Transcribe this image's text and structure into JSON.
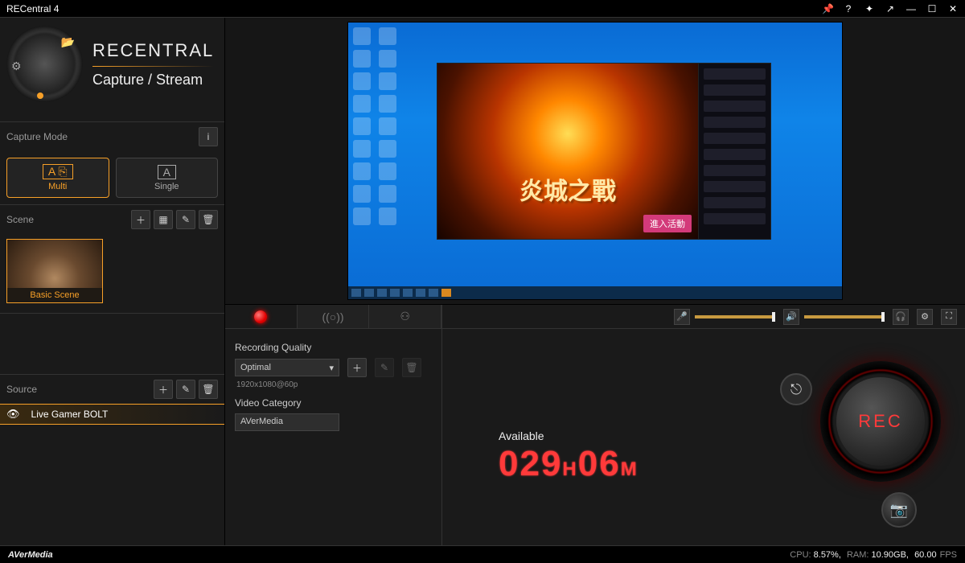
{
  "window": {
    "title": "RECentral 4"
  },
  "header": {
    "brand": "RECENTRAL",
    "mode": "Capture / Stream"
  },
  "capture_mode": {
    "label": "Capture Mode",
    "multi": "Multi",
    "single": "Single"
  },
  "scene": {
    "label": "Scene",
    "item": "Basic Scene"
  },
  "source": {
    "label": "Source",
    "item": "Live Gamer BOLT"
  },
  "preview": {
    "game_cjk": "炎城之戰",
    "cta": "進入活動"
  },
  "recording": {
    "quality_label": "Recording Quality",
    "quality_value": "Optimal",
    "quality_detail": "1920x1080@60p",
    "category_label": "Video Category",
    "category_value": "AVerMedia"
  },
  "available": {
    "label": "Available",
    "hours": "029",
    "h_unit": "H",
    "minutes": "06",
    "m_unit": "M"
  },
  "rec_button": "REC",
  "footer": {
    "brand": "AVerMedia",
    "cpu_label": "CPU:",
    "cpu_value": "8.57%,",
    "ram_label": "RAM:",
    "ram_value": "10.90GB,",
    "fps_value": "60.00",
    "fps_label": "FPS"
  }
}
